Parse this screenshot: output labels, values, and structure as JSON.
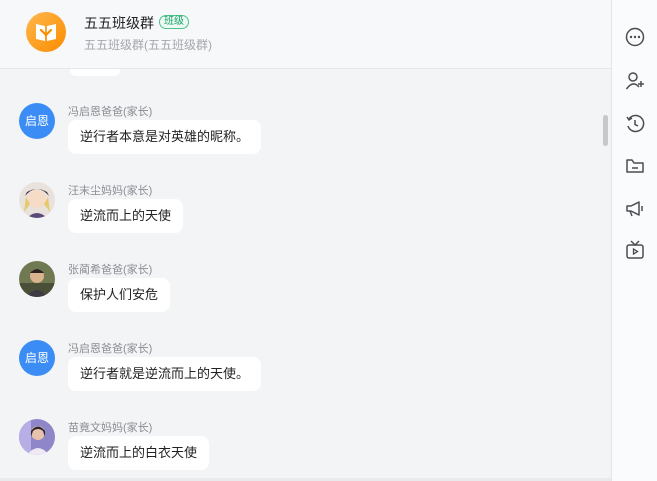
{
  "header": {
    "title": "五五班级群",
    "tag": "班级",
    "subtitle": "五五班级群(五五班级群)"
  },
  "messages": [
    {
      "sender": "冯启恩爸爸(家长)",
      "avatar_text": "启恩",
      "text": "逆行者本意是对英雄的昵称。"
    },
    {
      "sender": "汪末尘妈妈(家长)",
      "avatar_text": "",
      "text": "逆流而上的天使"
    },
    {
      "sender": "张蔺希爸爸(家长)",
      "avatar_text": "",
      "text": "保护人们安危"
    },
    {
      "sender": "冯启恩爸爸(家长)",
      "avatar_text": "启恩",
      "text": "逆行者就是逆流而上的天使。"
    },
    {
      "sender": "苗竟文妈妈(家长)",
      "avatar_text": "",
      "text": "逆流而上的白衣天使"
    }
  ],
  "sidebar": {
    "icons": [
      "more-icon",
      "add-member-icon",
      "history-icon",
      "folder-icon",
      "announcement-icon",
      "live-tv-icon"
    ]
  },
  "colors": {
    "accent_blue": "#3b8df5",
    "group_avatar_orange": "#fb8c00",
    "tag_green": "#1aa36a"
  }
}
